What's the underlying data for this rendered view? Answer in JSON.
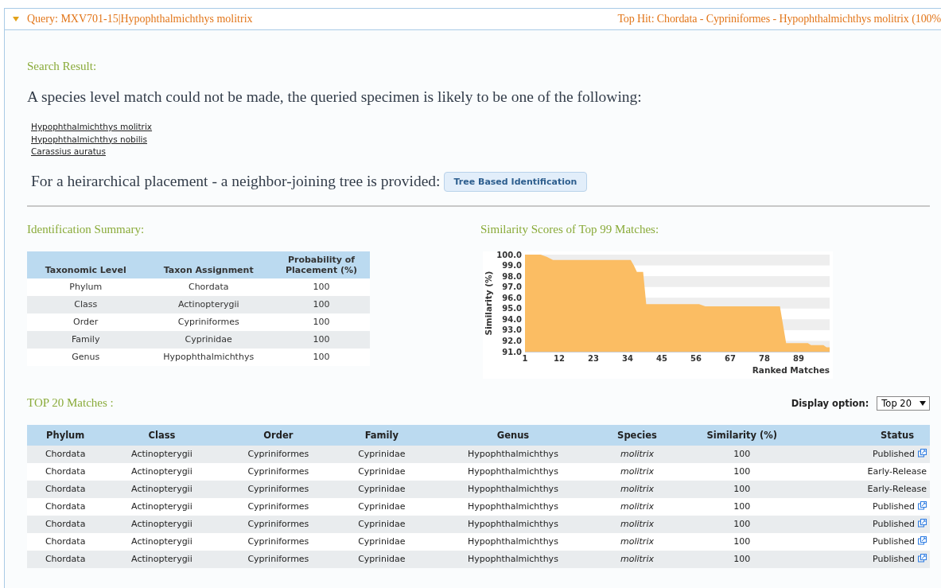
{
  "header": {
    "expanded": true,
    "query": "Query: MXV701-15|Hypophthalmichthys molitrix",
    "top_hit": "Top Hit: Chordata - Cypriniformes - Hypophthalmichthys molitrix (100%"
  },
  "search_result": {
    "heading": "Search Result:",
    "message": "A species level match could not be made, the queried specimen is likely to be one of the following:",
    "species_links": [
      "Hypophthalmichthys molitrix",
      "Hypophthalmichthys nobilis",
      "Carassius auratus"
    ],
    "tree_text": "For a heirarchical placement - a neighbor-joining tree is provided:",
    "tree_button": "Tree Based Identification"
  },
  "identification_summary": {
    "heading": "Identification Summary:",
    "columns": [
      "Taxonomic Level",
      "Taxon Assignment",
      "Probability of Placement (%)"
    ],
    "rows": [
      [
        "Phylum",
        "Chordata",
        "100"
      ],
      [
        "Class",
        "Actinopterygii",
        "100"
      ],
      [
        "Order",
        "Cypriniformes",
        "100"
      ],
      [
        "Family",
        "Cyprinidae",
        "100"
      ],
      [
        "Genus",
        "Hypophthalmichthys",
        "100"
      ]
    ]
  },
  "similarity_chart": {
    "chart_data": {
      "type": "area",
      "title": "Similarity Scores of Top 99 Matches:",
      "xlabel": "Ranked Matches",
      "ylabel": "Similarity (%)",
      "x": [
        1,
        6,
        8,
        10,
        35,
        36,
        37,
        39,
        40,
        57,
        59,
        83,
        85,
        92,
        93,
        97,
        98,
        99
      ],
      "series": [
        {
          "color": "#fbbd63",
          "values": [
            100,
            100,
            99.8,
            99.5,
            99.5,
            99.0,
            98.4,
            98.4,
            95.4,
            95.4,
            95.2,
            95.2,
            91.8,
            91.8,
            91.6,
            91.6,
            91.4,
            91.4
          ]
        }
      ],
      "xlim": [
        1,
        99
      ],
      "ylim": [
        91,
        100
      ],
      "xticks": [
        1,
        12,
        23,
        34,
        45,
        56,
        67,
        78,
        89
      ],
      "yticks": [
        {
          "value": 91,
          "label": "91.0"
        },
        {
          "value": 92,
          "label": "92.0"
        },
        {
          "value": 93,
          "label": "93.0"
        },
        {
          "value": 94,
          "label": "94.0"
        },
        {
          "value": 95,
          "label": "95.0"
        },
        {
          "value": 96,
          "label": "96.0"
        },
        {
          "value": 97,
          "label": "97.0"
        },
        {
          "value": 98,
          "label": "98.0"
        },
        {
          "value": 99,
          "label": "99.0"
        },
        {
          "value": 100,
          "label": "100.0"
        }
      ]
    }
  },
  "top_matches": {
    "heading": "TOP 20 Matches :",
    "display_label": "Display option:",
    "display_value": "Top 20",
    "columns": [
      "Phylum",
      "Class",
      "Order",
      "Family",
      "Genus",
      "Species",
      "Similarity (%)",
      "Status"
    ],
    "rows": [
      {
        "cells": [
          "Chordata",
          "Actinopterygii",
          "Cypriniformes",
          "Cyprinidae",
          "Hypophthalmichthys",
          "molitrix",
          "100"
        ],
        "status": "Published",
        "link": true
      },
      {
        "cells": [
          "Chordata",
          "Actinopterygii",
          "Cypriniformes",
          "Cyprinidae",
          "Hypophthalmichthys",
          "molitrix",
          "100"
        ],
        "status": "Early-Release",
        "link": false
      },
      {
        "cells": [
          "Chordata",
          "Actinopterygii",
          "Cypriniformes",
          "Cyprinidae",
          "Hypophthalmichthys",
          "molitrix",
          "100"
        ],
        "status": "Early-Release",
        "link": false
      },
      {
        "cells": [
          "Chordata",
          "Actinopterygii",
          "Cypriniformes",
          "Cyprinidae",
          "Hypophthalmichthys",
          "molitrix",
          "100"
        ],
        "status": "Published",
        "link": true
      },
      {
        "cells": [
          "Chordata",
          "Actinopterygii",
          "Cypriniformes",
          "Cyprinidae",
          "Hypophthalmichthys",
          "molitrix",
          "100"
        ],
        "status": "Published",
        "link": true
      },
      {
        "cells": [
          "Chordata",
          "Actinopterygii",
          "Cypriniformes",
          "Cyprinidae",
          "Hypophthalmichthys",
          "molitrix",
          "100"
        ],
        "status": "Published",
        "link": true
      },
      {
        "cells": [
          "Chordata",
          "Actinopterygii",
          "Cypriniformes",
          "Cyprinidae",
          "Hypophthalmichthys",
          "molitrix",
          "100"
        ],
        "status": "Published",
        "link": true
      }
    ]
  }
}
